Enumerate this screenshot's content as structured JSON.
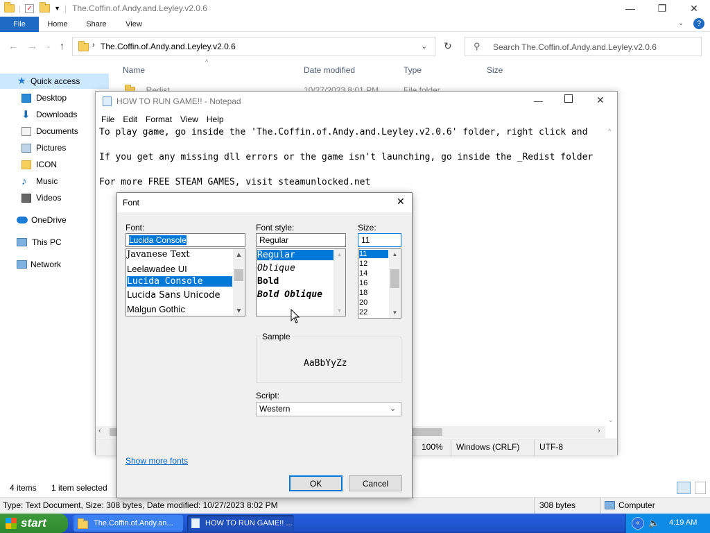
{
  "explorer": {
    "title": "The.Coffin.of.Andy.and.Leyley.v2.0.6",
    "ribbon_tabs": [
      "File",
      "Home",
      "Share",
      "View"
    ],
    "address": "The.Coffin.of.Andy.and.Leyley.v2.0.6",
    "search_placeholder": "Search The.Coffin.of.Andy.and.Leyley.v2.0.6",
    "columns": [
      "Name",
      "Date modified",
      "Type",
      "Size"
    ],
    "rows": [
      {
        "name": "_Redist",
        "date": "10/27/2023 8:01 PM",
        "type": "File folder"
      }
    ],
    "nav": [
      "Quick access",
      "Desktop",
      "Downloads",
      "Documents",
      "Pictures",
      "ICON",
      "Music",
      "Videos",
      "OneDrive",
      "This PC",
      "Network"
    ],
    "status_items": "4 items",
    "status_selected": "1 item selected",
    "details_bar": "Type: Text Document, Size: 308 bytes, Date modified: 10/27/2023 8:02 PM",
    "details_size": "308 bytes",
    "details_location": "Computer"
  },
  "notepad": {
    "title": "HOW TO RUN GAME!! - Notepad",
    "menu": [
      "File",
      "Edit",
      "Format",
      "View",
      "Help"
    ],
    "lines": [
      "To play game, go inside the 'The.Coffin.of.Andy.and.Leyley.v2.0.6' folder, right click and",
      "If you get any missing dll errors or the game isn't launching, go inside the _Redist folder",
      "For more FREE STEAM GAMES, visit steamunlocked.net"
    ],
    "status_zoom": "100%",
    "status_eol": "Windows (CRLF)",
    "status_encoding": "UTF-8"
  },
  "font_dialog": {
    "title": "Font",
    "font_label": "Font:",
    "font_value": "Lucida Console",
    "font_list": [
      "Javanese Text",
      "Leelawadee UI",
      "Lucida Console",
      "Lucida Sans Unicode",
      "Malgun Gothic"
    ],
    "style_label": "Font style:",
    "style_value": "Regular",
    "style_list": [
      "Regular",
      "Oblique",
      "Bold",
      "Bold Oblique"
    ],
    "size_label": "Size:",
    "size_value": "11",
    "size_list": [
      "11",
      "12",
      "14",
      "16",
      "18",
      "20",
      "22"
    ],
    "sample_label": "Sample",
    "sample_text": "AaBbYyZz",
    "script_label": "Script:",
    "script_value": "Western",
    "more_fonts": "Show more fonts",
    "ok": "OK",
    "cancel": "Cancel"
  },
  "taskbar": {
    "start": "start",
    "items": [
      "The.Coffin.of.Andy.an...",
      "HOW TO RUN GAME!! ..."
    ],
    "clock": "4:19 AM"
  },
  "colors": {
    "accent": "#0078d7",
    "file_tab": "#1f6ac2",
    "taskbar": "#245edb",
    "start": "#3c9a3c"
  }
}
